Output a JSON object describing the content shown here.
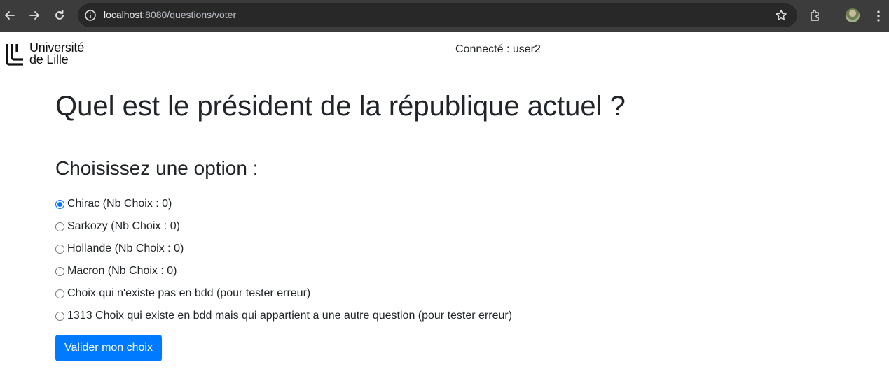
{
  "browser": {
    "url_host": "localhost",
    "url_rest": ":8080/questions/voter"
  },
  "header": {
    "logo_line1": "Université",
    "logo_line2": "de Lille",
    "connected_text": "Connecté : user2"
  },
  "question": {
    "title": "Quel est le président de la république actuel ?",
    "options_heading": "Choisissez une option :",
    "options": [
      {
        "label": "Chirac (Nb Choix : 0)",
        "checked": true
      },
      {
        "label": "Sarkozy (Nb Choix : 0)",
        "checked": false
      },
      {
        "label": "Hollande (Nb Choix : 0)",
        "checked": false
      },
      {
        "label": "Macron (Nb Choix : 0)",
        "checked": false
      },
      {
        "label": "Choix qui n'existe pas en bdd (pour tester erreur)",
        "checked": false
      },
      {
        "label": "1313 Choix qui existe en bdd mais qui appartient a une autre question (pour tester erreur)",
        "checked": false
      }
    ],
    "submit_label": "Valider mon choix"
  },
  "colors": {
    "primary": "#007bff",
    "browser_bar": "#3c3c3c",
    "omnibox": "#282828"
  }
}
